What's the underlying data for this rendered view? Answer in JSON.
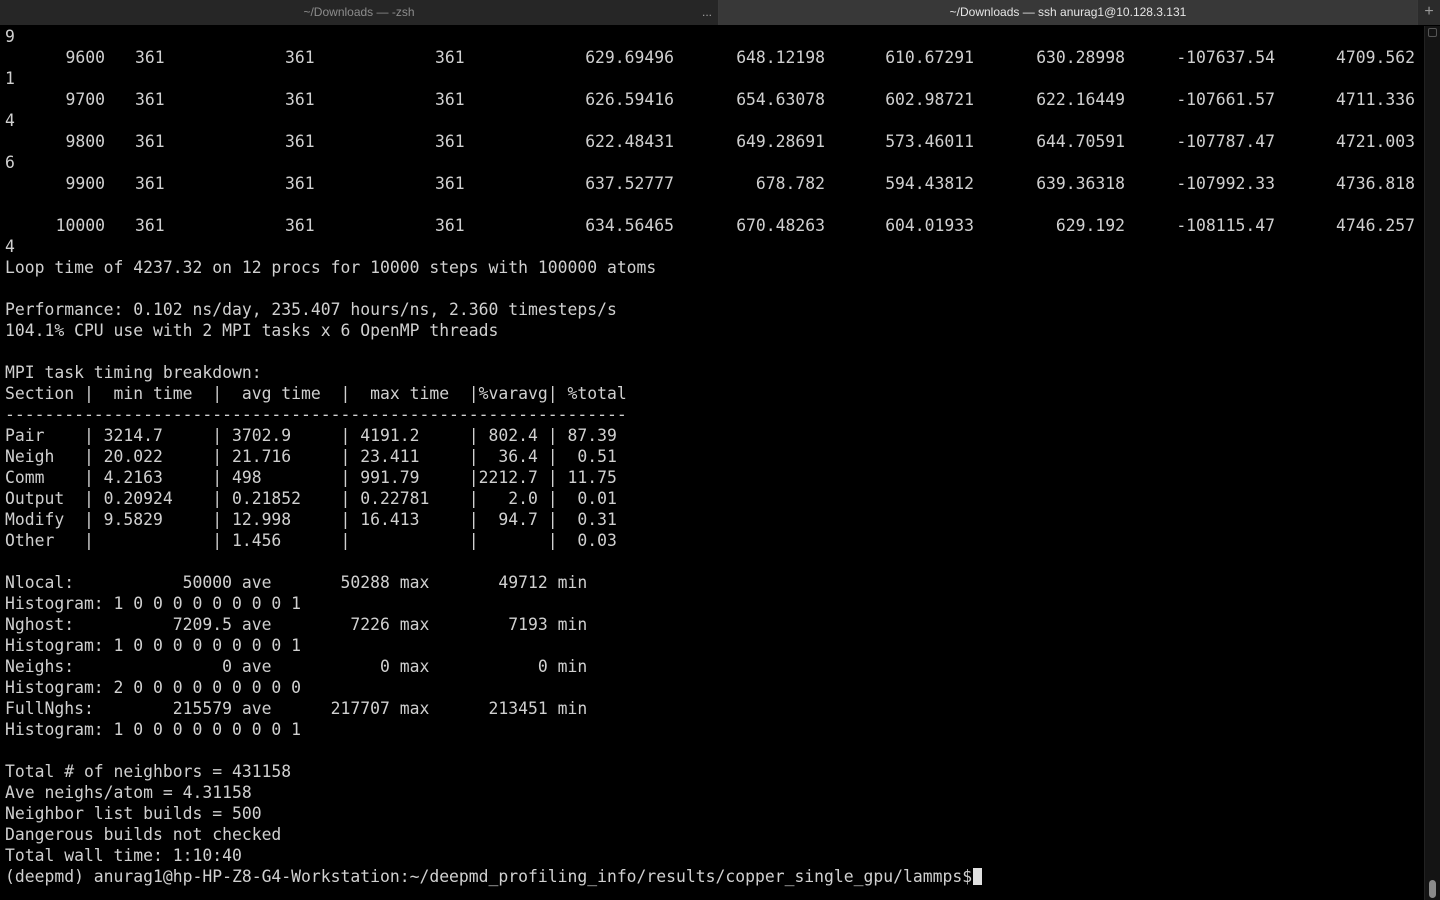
{
  "tabs": [
    {
      "title": "~/Downloads — -zsh",
      "active": false,
      "more_label": "..."
    },
    {
      "title": "~/Downloads — ssh anurag1@10.128.3.131",
      "active": true
    }
  ],
  "new_tab_label": "+",
  "thermo_rows": [
    {
      "wrap": "9",
      "step": "9600",
      "c1": "361",
      "c2": "361",
      "c3": "361",
      "c4": "629.69496",
      "c5": "648.12198",
      "c6": "610.67291",
      "c7": "630.28998",
      "c8": "-107637.54",
      "c9": "4709.562"
    },
    {
      "wrap": "1",
      "step": "9700",
      "c1": "361",
      "c2": "361",
      "c3": "361",
      "c4": "626.59416",
      "c5": "654.63078",
      "c6": "602.98721",
      "c7": "622.16449",
      "c8": "-107661.57",
      "c9": "4711.336"
    },
    {
      "wrap": "4",
      "step": "9800",
      "c1": "361",
      "c2": "361",
      "c3": "361",
      "c4": "622.48431",
      "c5": "649.28691",
      "c6": "573.46011",
      "c7": "644.70591",
      "c8": "-107787.47",
      "c9": "4721.003"
    },
    {
      "wrap": "6",
      "step": "9900",
      "c1": "361",
      "c2": "361",
      "c3": "361",
      "c4": "637.52777",
      "c5": "678.782",
      "c6": "594.43812",
      "c7": "639.36318",
      "c8": "-107992.33",
      "c9": "4736.818"
    },
    {
      "wrap": "",
      "step": "10000",
      "c1": "361",
      "c2": "361",
      "c3": "361",
      "c4": "634.56465",
      "c5": "670.48263",
      "c6": "604.01933",
      "c7": "629.192",
      "c8": "-108115.47",
      "c9": "4746.257"
    }
  ],
  "trailing_wrap": "4",
  "output_lines": [
    "Loop time of 4237.32 on 12 procs for 10000 steps with 100000 atoms",
    "",
    "Performance: 0.102 ns/day, 235.407 hours/ns, 2.360 timesteps/s",
    "104.1% CPU use with 2 MPI tasks x 6 OpenMP threads",
    "",
    "MPI task timing breakdown:",
    "Section |  min time  |  avg time  |  max time  |%varavg| %total",
    "---------------------------------------------------------------",
    "Pair    | 3214.7     | 3702.9     | 4191.2     | 802.4 | 87.39",
    "Neigh   | 20.022     | 21.716     | 23.411     |  36.4 |  0.51",
    "Comm    | 4.2163     | 498        | 991.79     |2212.7 | 11.75",
    "Output  | 0.20924    | 0.21852    | 0.22781    |   2.0 |  0.01",
    "Modify  | 9.5829     | 12.998     | 16.413     |  94.7 |  0.31",
    "Other   |            | 1.456      |            |       |  0.03",
    "",
    "Nlocal:           50000 ave       50288 max       49712 min",
    "Histogram: 1 0 0 0 0 0 0 0 0 1",
    "Nghost:          7209.5 ave        7226 max        7193 min",
    "Histogram: 1 0 0 0 0 0 0 0 0 1",
    "Neighs:               0 ave           0 max           0 min",
    "Histogram: 2 0 0 0 0 0 0 0 0 0",
    "FullNghs:        215579 ave      217707 max      213451 min",
    "Histogram: 1 0 0 0 0 0 0 0 0 1",
    "",
    "Total # of neighbors = 431158",
    "Ave neighs/atom = 4.31158",
    "Neighbor list builds = 500",
    "Dangerous builds not checked",
    "Total wall time: 1:10:40"
  ],
  "prompt": "(deepmd) anurag1@hp-HP-Z8-G4-Workstation:~/deepmd_profiling_info/results/copper_single_gpu/lammps$"
}
